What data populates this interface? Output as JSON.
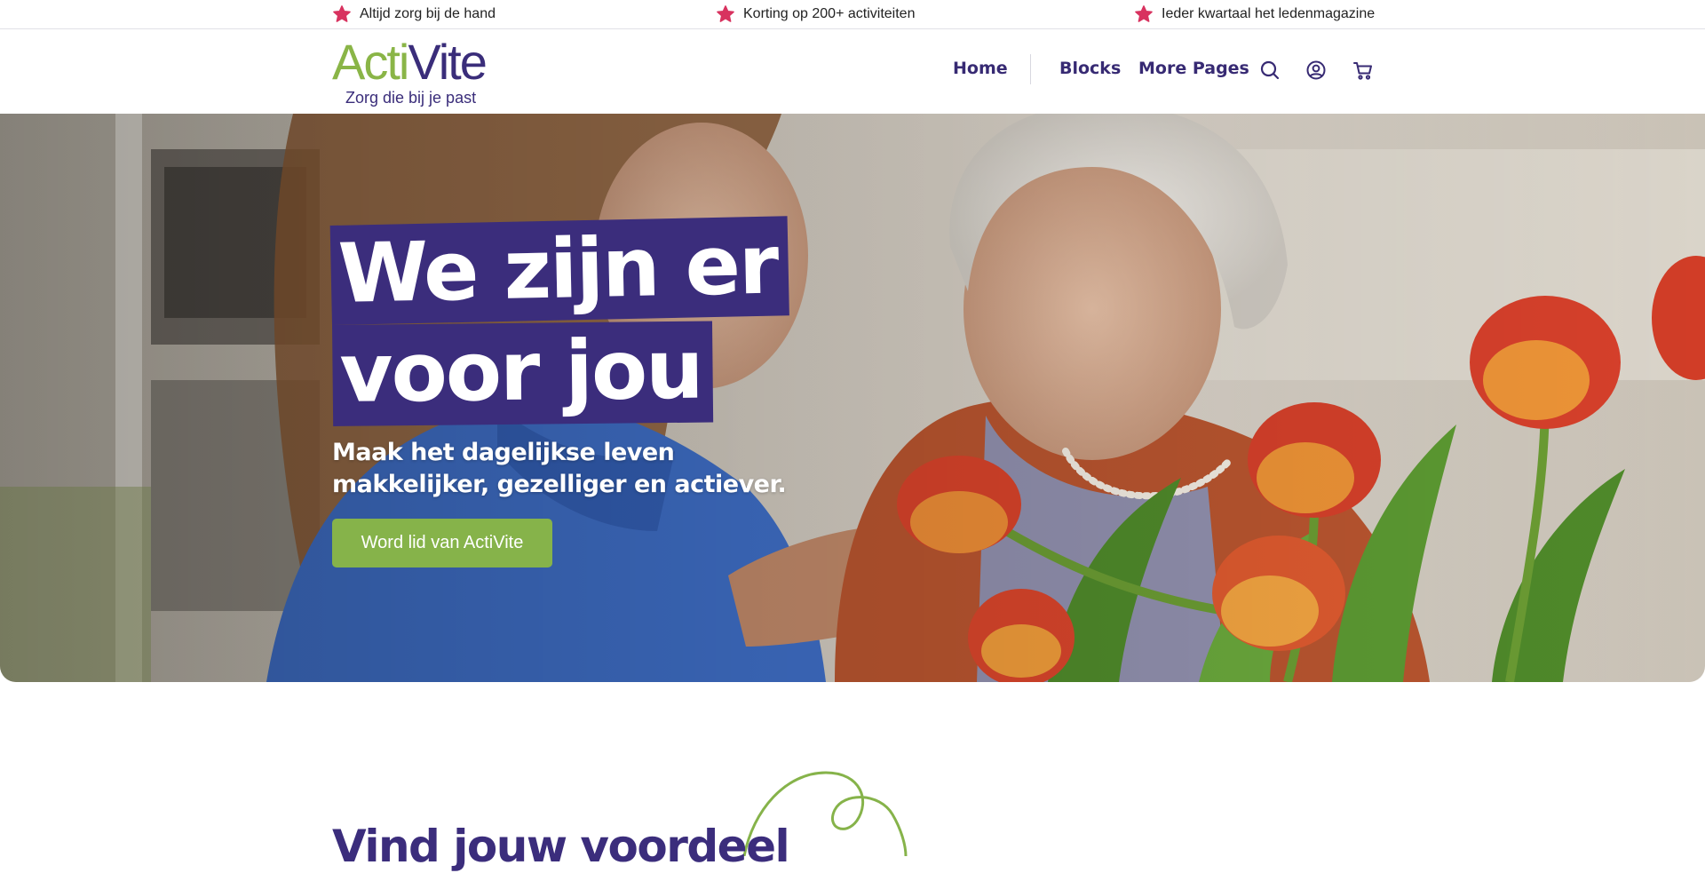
{
  "usp_bar": {
    "items": [
      {
        "label": "Altijd zorg bij de hand",
        "icon": "flower-icon"
      },
      {
        "label": "Korting op 200+ activiteiten",
        "icon": "flower-icon"
      },
      {
        "label": "Ieder kwartaal het ledenmagazine",
        "icon": "flower-icon"
      }
    ]
  },
  "header": {
    "logo": {
      "word_part1": "Acti",
      "word_part2": "Vite",
      "tagline": "Zorg die bij je past"
    },
    "nav": {
      "home": "Home",
      "blocks": "Blocks",
      "more_pages": "More Pages"
    },
    "icons": [
      "search-icon",
      "account-icon",
      "cart-icon"
    ]
  },
  "hero": {
    "title_line1": "We zijn er",
    "title_line2": "voor jou",
    "subtitle": "Maak het dagelijkse leven makkelijker, gezelliger en actiever.",
    "cta_label": "Word lid van ActiVite"
  },
  "section": {
    "title": "Vind jouw voordeel"
  },
  "colors": {
    "brand_purple": "#3b2d7c",
    "brand_green": "#86b34a",
    "flower_pink": "#d8325f",
    "text_dark": "#222222"
  }
}
